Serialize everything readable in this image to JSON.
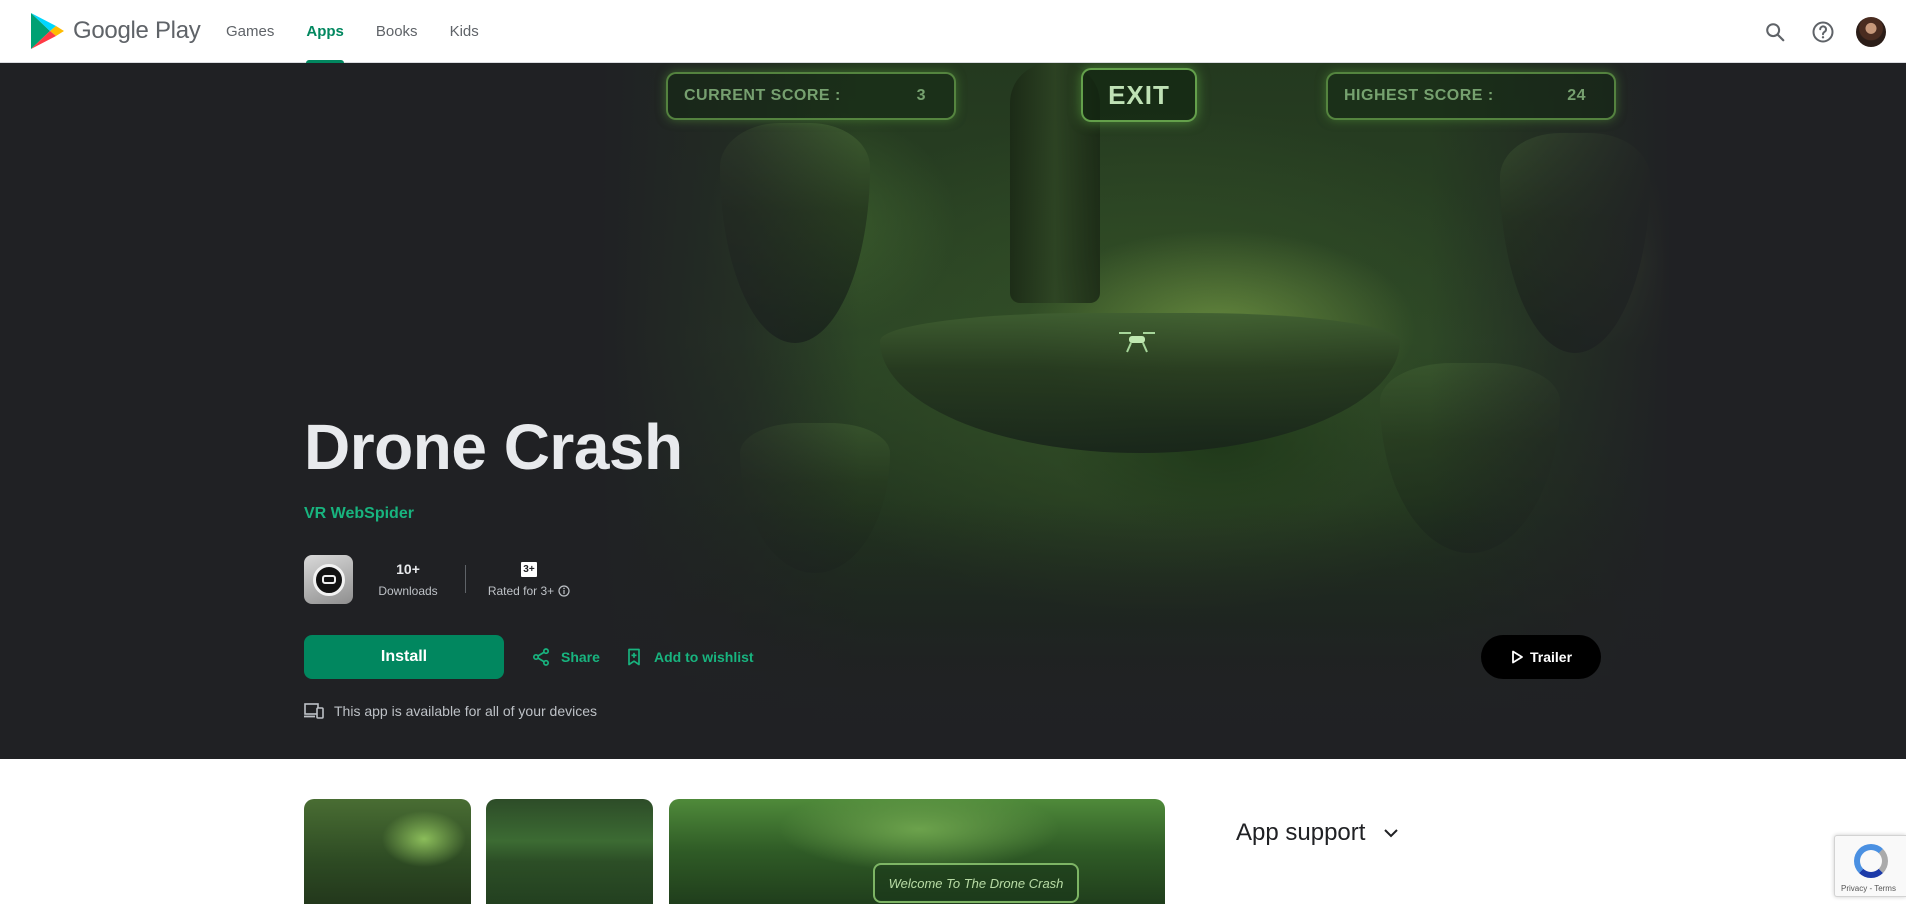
{
  "header": {
    "brand": "Google Play",
    "nav": [
      {
        "label": "Games",
        "active": false
      },
      {
        "label": "Apps",
        "active": true
      },
      {
        "label": "Books",
        "active": false
      },
      {
        "label": "Kids",
        "active": false
      }
    ],
    "icons": [
      "search-icon",
      "help-icon",
      "avatar"
    ]
  },
  "hero": {
    "game_hud": {
      "current_score_label": "CURRENT SCORE :",
      "current_score": "3",
      "exit": "EXIT",
      "highest_score_label": "HIGHEST SCORE :",
      "highest_score": "24"
    },
    "title": "Drone Crash",
    "developer": "VR WebSpider",
    "downloads_value": "10+",
    "downloads_label": "Downloads",
    "rating_badge": "3+",
    "rating_label": "Rated for 3+",
    "install": "Install",
    "share": "Share",
    "wishlist": "Add to wishlist",
    "trailer": "Trailer",
    "devices_note": "This app is available for all of your devices"
  },
  "screenshots": {
    "welcome_text": "Welcome To The Drone Crash"
  },
  "sidebar": {
    "app_support": "App support"
  },
  "recaptcha": {
    "footer": "Privacy - Terms"
  },
  "colors": {
    "accent": "#01875f",
    "accent_light": "#18b47f",
    "hero_bg": "#202124"
  }
}
